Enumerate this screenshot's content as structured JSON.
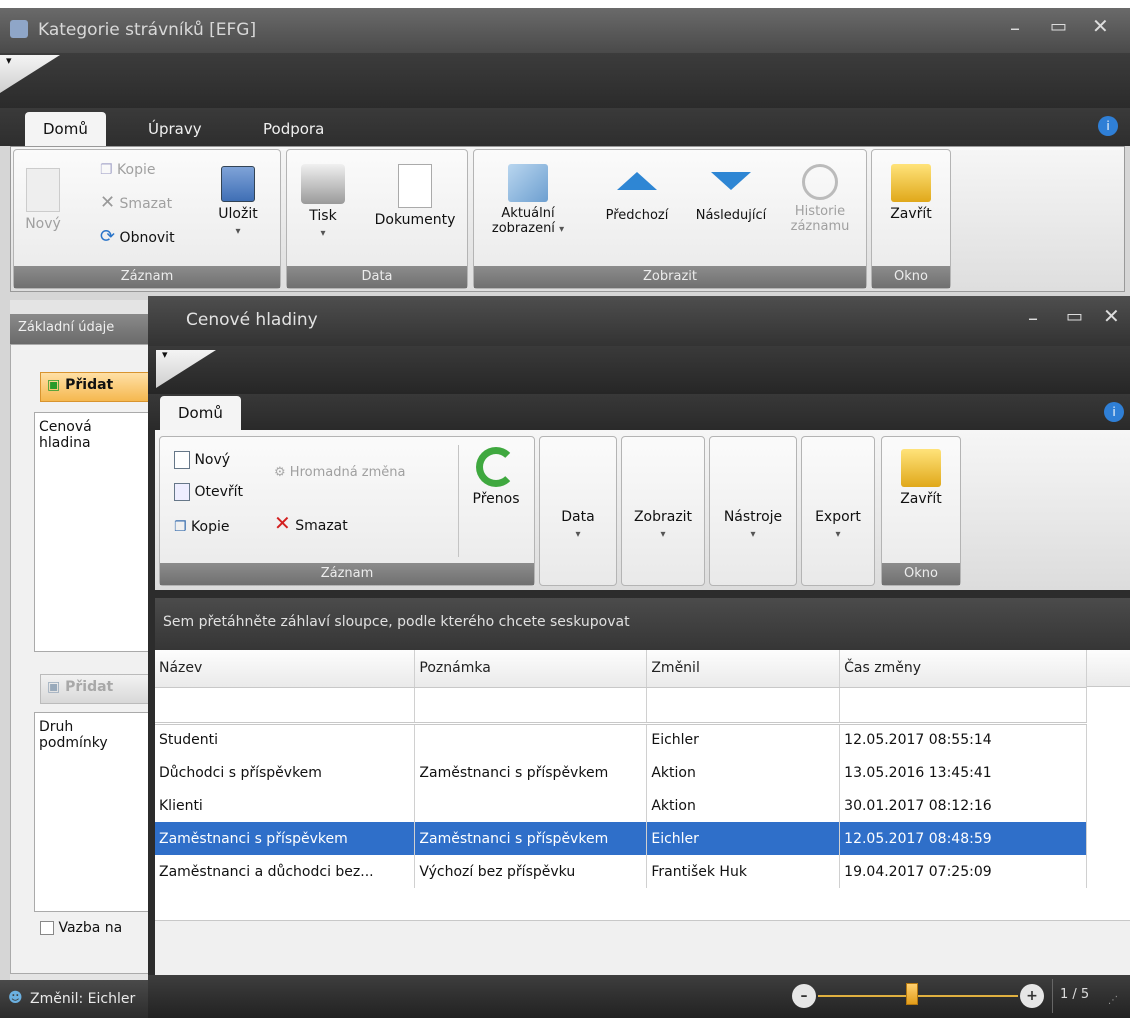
{
  "bg_window": {
    "title": "Kategorie strávníků [EFG]",
    "tabs": [
      "Domů",
      "Úpravy",
      "Podpora"
    ],
    "groups": {
      "zaznam": {
        "label": "Záznam",
        "novy": "Nový",
        "kopie": "Kopie",
        "smazat": "Smazat",
        "obnovit": "Obnovit",
        "ulozit": "Uložit"
      },
      "data": {
        "label": "Data",
        "tisk": "Tisk",
        "dokumenty": "Dokumenty"
      },
      "zobrazit": {
        "label": "Zobrazit",
        "aktualni1": "Aktuální",
        "aktualni2": "zobrazení",
        "predchozi": "Předchozí",
        "nasledujici": "Následující",
        "historie1": "Historie",
        "historie2": "záznamu"
      },
      "okno": {
        "label": "Okno",
        "zavrit": "Zavřít"
      }
    },
    "side_tab": "Základní údaje",
    "pridat1": "Přidat",
    "list1_header": "Cenová hladina",
    "pridat2": "Přidat",
    "list2_header": "Druh podmínky",
    "vazba_checkbox": "Vazba na",
    "status": "Změnil: Eichler"
  },
  "fg_window": {
    "title": "Cenové hladiny",
    "tab": "Domů",
    "groups": {
      "zaznam": {
        "label": "Záznam",
        "novy": "Nový",
        "otevrit": "Otevřít",
        "kopie": "Kopie",
        "hromadna": "Hromadná změna",
        "smazat": "Smazat",
        "prenos": "Přenos"
      },
      "data": "Data",
      "zobrazit": "Zobrazit",
      "nastroje": "Nástroje",
      "export": "Export",
      "okno": {
        "label": "Okno",
        "zavrit": "Zavřít"
      }
    },
    "group_hint": "Sem přetáhněte záhlaví sloupce, podle kterého chcete seskupovat",
    "columns": [
      "Název",
      "Poznámka",
      "Změnil",
      "Čas změny"
    ],
    "rows": [
      [
        "Studenti",
        "",
        "Eichler",
        "12.05.2017 08:55:14"
      ],
      [
        "Důchodci s příspěvkem",
        "Zaměstnanci s příspěvkem",
        "Aktion",
        "13.05.2016 13:45:41"
      ],
      [
        "Klienti",
        "",
        "Aktion",
        "30.01.2017 08:12:16"
      ],
      [
        "Zaměstnanci s příspěvkem",
        "Zaměstnanci s příspěvkem",
        "Eichler",
        "12.05.2017 08:48:59"
      ],
      [
        "Zaměstnanci a důchodci bez...",
        "Výchozí bez příspěvku",
        "František Huk",
        "19.04.2017 07:25:09"
      ]
    ],
    "selected_row": 3,
    "zoom_level": 0.47,
    "page": "1 / 5"
  }
}
